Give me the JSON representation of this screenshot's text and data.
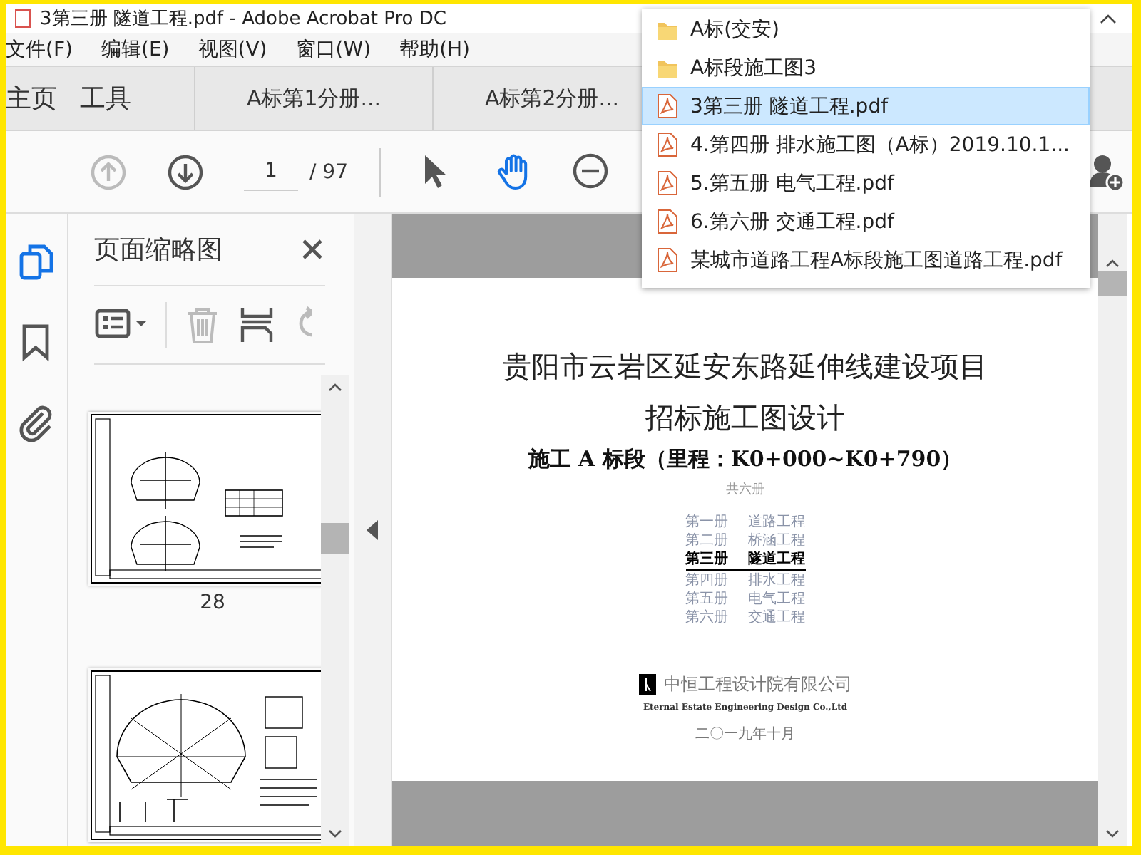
{
  "window": {
    "title": "3第三册 隧道工程.pdf - Adobe Acrobat Pro DC"
  },
  "menu": [
    "文件(F)",
    "编辑(E)",
    "视图(V)",
    "窗口(W)",
    "帮助(H)"
  ],
  "tabs": [
    {
      "label": "主页",
      "selected": false
    },
    {
      "label": "工具",
      "selected": false
    },
    {
      "label": "A标第1分册...",
      "selected": false
    },
    {
      "label": "A标第2分册...",
      "selected": false
    }
  ],
  "toolbar": {
    "nav": [
      {
        "kind": "prev-page",
        "disabled": true
      },
      {
        "kind": "next-page",
        "disabled": false
      }
    ],
    "page_field": {
      "value": "1"
    },
    "page_total": "/ 97",
    "tools": [
      {
        "kind": "select",
        "selected": false
      },
      {
        "kind": "hand",
        "selected": true
      },
      {
        "kind": "zoom-out",
        "selected": false
      }
    ]
  },
  "side_rail": [
    {
      "kind": "pages",
      "selected": true
    },
    {
      "kind": "bookmarks",
      "selected": false
    },
    {
      "kind": "attachments",
      "selected": false
    }
  ],
  "thumbnail_panel": {
    "title": "页面缩略图",
    "tools": [
      {
        "kind": "options",
        "disabled": false
      },
      {
        "kind": "delete",
        "disabled": true
      },
      {
        "kind": "insert",
        "disabled": false
      },
      {
        "kind": "rotate",
        "disabled": true
      }
    ],
    "thumbnails": [
      {
        "kind": "section",
        "label": "28"
      },
      {
        "kind": "detail"
      }
    ]
  },
  "document": {
    "title_lines": [
      "贵阳市云岩区延安东路延伸线建设项目",
      "招标施工图设计"
    ],
    "subtitle": "施工 A 标段（里程：K0+000~K0+790）",
    "volume_count": "共六册",
    "volumes": [
      {
        "number": "第一册",
        "title": "道路工程",
        "current": false
      },
      {
        "number": "第二册",
        "title": "桥涵工程",
        "current": false
      },
      {
        "number": "第三册",
        "title": "隧道工程",
        "current": true
      },
      {
        "number": "第四册",
        "title": "排水工程",
        "current": false
      },
      {
        "number": "第五册",
        "title": "电气工程",
        "current": false
      },
      {
        "number": "第六册",
        "title": "交通工程",
        "current": false
      }
    ],
    "company": "中恒工程设计院有限公司",
    "company_english": "Eternal Estate Engineering Design Co.,Ltd",
    "date": "二〇一九年十月"
  },
  "dropdown": [
    {
      "kind": "folder",
      "label": "A标(交安)",
      "selected": false
    },
    {
      "kind": "folder",
      "label": "A标段施工图3",
      "selected": false
    },
    {
      "kind": "pdf",
      "label": "3第三册 隧道工程.pdf",
      "selected": true
    },
    {
      "kind": "pdf",
      "label": "4.第四册 排水施工图（A标）2019.10.1...",
      "selected": false
    },
    {
      "kind": "pdf",
      "label": "5.第五册 电气工程.pdf",
      "selected": false
    },
    {
      "kind": "pdf",
      "label": "6.第六册 交通工程.pdf",
      "selected": false
    },
    {
      "kind": "pdf",
      "label": "某城市道路工程A标段施工图道路工程.pdf",
      "selected": false
    }
  ]
}
